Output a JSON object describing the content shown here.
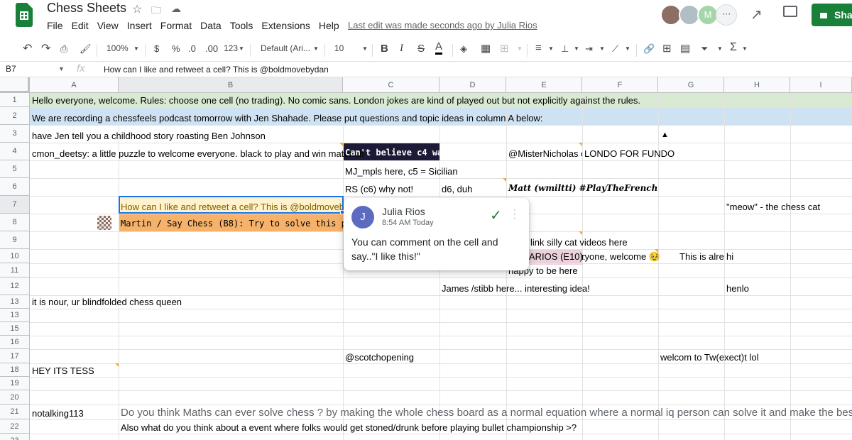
{
  "app": {
    "doc_title": "Chess Sheets",
    "menu": [
      "File",
      "Edit",
      "View",
      "Insert",
      "Format",
      "Data",
      "Tools",
      "Extensions",
      "Help"
    ],
    "last_edit": "Last edit was made seconds ago by Julia Rios",
    "share_label": "Shar",
    "avatar_letter": "M",
    "brand_color": "#188038"
  },
  "toolbar": {
    "zoom": "100%",
    "currency": "$",
    "percent": "%",
    "dec_less": ".0",
    "dec_more": ".00",
    "format_more": "123",
    "font": "Default (Ari...",
    "font_size": "10",
    "bold": "B",
    "italic": "I",
    "strike": "S",
    "text_color": "A"
  },
  "formula_bar": {
    "cell_ref": "B7",
    "fx": "fx",
    "value": "How can I like and retweet a cell? This is @boldmovebydan"
  },
  "columns": [
    "A",
    "B",
    "C",
    "D",
    "E",
    "F",
    "G",
    "H",
    "I"
  ],
  "rows": [
    "1",
    "2",
    "3",
    "4",
    "5",
    "6",
    "7",
    "8",
    "9",
    "10",
    "11",
    "12",
    "13",
    "15",
    "16",
    "17",
    "18",
    "19",
    "20",
    "21",
    "22",
    "23"
  ],
  "cells": {
    "r1_a": "Hello everyone, welcome. Rules: choose one cell (no trading). No comic sans. London jokes are kind of played out but not explicitly against the rules.",
    "r2_a": "We are recording a chessfeels podcast tomorrow with Jen Shahade. Please put questions and topic ideas in column A below:",
    "r3_a": "have Jen tell you a childhood story roasting Ben Johnson",
    "r3_f": "▲",
    "r4_a": "cmon_deetsy: a little puzzle to welcome everyone. black to play and win material!",
    "r4_c": "Can't believe c4 wa",
    "r4_e": "@MisterNicholas o",
    "r4_f": "LONDO FOR FUNDO",
    "r5_c": "MJ_mpls here, c5 = Sicilian",
    "r6_c": "RS (c6) why not!",
    "r6_d": "d6, duh",
    "r6_e": "Matt (wmiltti) #PlayTheFrench",
    "r7_b": "How can I like and retweet a cell? This is @boldmovebydan",
    "r7_h": "\"meow\" - the chess cat",
    "r8_b": "Martin / Say Chess (B8): Try to solve this p",
    "r9_e": "link silly cat videos here",
    "r10_e": "ARIOS (E10): Hi everyone, welcome 🥹",
    "r10_g": "This is alrea",
    "r10_h": "hi",
    "r11_e": "happy to be here",
    "r12_d": "James /stibb here... interesting idea!",
    "r12_h": "henlo",
    "r13_a": "it is nour, ur blindfolded chess queen",
    "r17_c": "@scotchopening",
    "r17_g": "welcom to Tw(exect)t lol",
    "r18_a": "HEY ITS TESS",
    "r21_a": "notalking113",
    "r21_b": "Do you think Maths can ever solve chess ? by making the whole chess board as a normal equation where a normal iq person can solve it and make the best move in the",
    "r22_b": "Also what do you think about a event where folks would get stoned/drunk before playing bullet championship >?"
  },
  "comment": {
    "avatar": "J",
    "author": "Julia Rios",
    "time": "8:54 AM Today",
    "text": "You can comment on the cell and say..\"I like this!\""
  }
}
